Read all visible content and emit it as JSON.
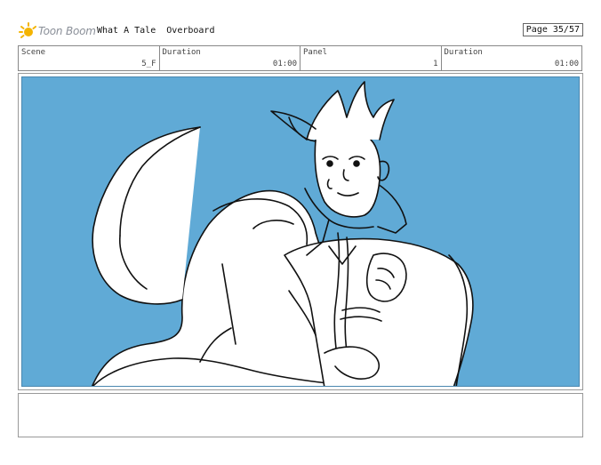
{
  "header": {
    "logo_text": "Toon Boom",
    "project_title": "What A Tale",
    "sequence_title": "Overboard",
    "page_label": "Page 35/57"
  },
  "info": {
    "scene_label": "Scene",
    "scene_value": "5_F",
    "scene_duration_label": "Duration",
    "scene_duration_value": "01:00",
    "panel_label": "Panel",
    "panel_value": "1",
    "panel_duration_label": "Duration",
    "panel_duration_value": "01:00"
  },
  "panel": {
    "background_color": "#60aad6",
    "line_color": "#111111"
  },
  "notes": {
    "text": ""
  }
}
